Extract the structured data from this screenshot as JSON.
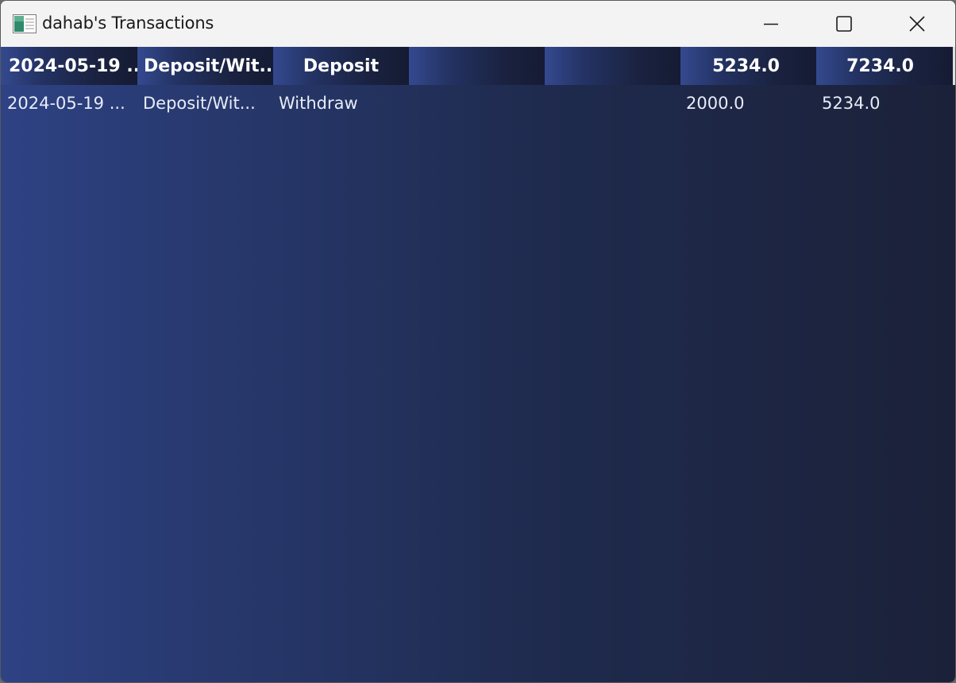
{
  "window": {
    "title": "dahab's Transactions",
    "app_icon": "spreadsheet-app-icon",
    "controls": {
      "minimize_icon": "minimize-icon",
      "maximize_icon": "maximize-icon",
      "close_icon": "close-icon"
    }
  },
  "table": {
    "header": [
      "2024-05-19 ...",
      "Deposit/Wit...",
      "Deposit",
      "",
      "",
      "5234.0",
      "7234.0"
    ],
    "rows": [
      [
        "2024-05-19 ...",
        "Deposit/Wit...",
        "Withdraw",
        "",
        "",
        "2000.0",
        "5234.0"
      ]
    ]
  },
  "colors": {
    "background_gradient_start": "#2e4284",
    "background_gradient_end": "#1b2139",
    "text": "#ffffff"
  }
}
